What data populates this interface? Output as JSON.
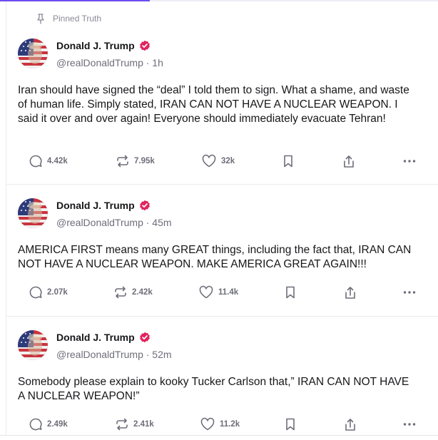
{
  "pinned_label": "Pinned Truth",
  "colors": {
    "accent": "#6d4df2",
    "verified": "#e0245e"
  },
  "posts": [
    {
      "author": "Donald J. Trump",
      "handle": "@realDonaldTrump",
      "time": "1h",
      "handle_line": "@realDonaldTrump · 1h",
      "text": "Iran should have signed the “deal” I told them to sign. What a shame, and waste of human life. Simply stated, IRAN CAN NOT HAVE A NUCLEAR WEAPON. I said it over and over again! Everyone should immediately evacuate Tehran!",
      "replies": "4.42k",
      "retruths": "7.95k",
      "likes": "32k"
    },
    {
      "author": "Donald J. Trump",
      "handle": "@realDonaldTrump",
      "time": "45m",
      "handle_line": "@realDonaldTrump · 45m",
      "text": "AMERICA FIRST means many GREAT things, including the fact that, IRAN CAN NOT HAVE A NUCLEAR WEAPON. MAKE AMERICA GREAT AGAIN!!!",
      "replies": "2.07k",
      "retruths": "2.42k",
      "likes": "11.4k"
    },
    {
      "author": "Donald J. Trump",
      "handle": "@realDonaldTrump",
      "time": "52m",
      "handle_line": "@realDonaldTrump · 52m",
      "text": "Somebody please explain to kooky Tucker Carlson that,” IRAN CAN NOT HAVE A NUCLEAR WEAPON!”",
      "replies": "2.49k",
      "retruths": "2.41k",
      "likes": "11.2k"
    }
  ]
}
